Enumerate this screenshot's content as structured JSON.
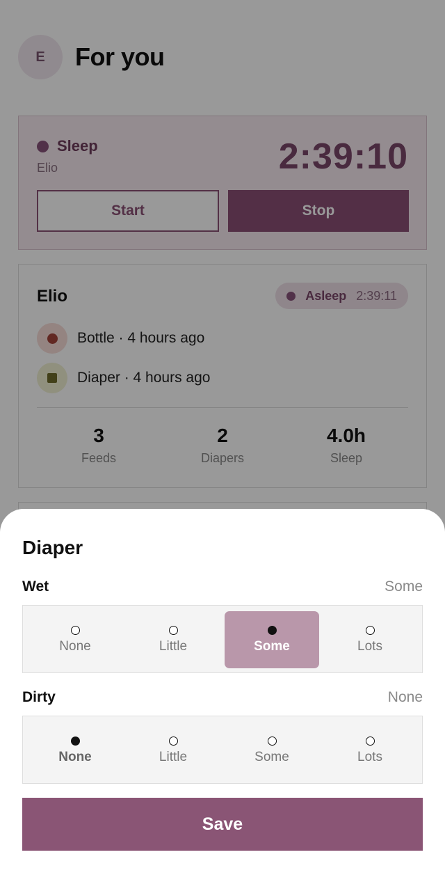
{
  "header": {
    "avatar_initial": "E",
    "title": "For you"
  },
  "timer": {
    "kind": "Sleep",
    "child": "Elio",
    "elapsed": "2:39:10",
    "start_label": "Start",
    "stop_label": "Stop"
  },
  "child_card": {
    "name": "Elio",
    "status": {
      "label": "Asleep",
      "time": "2:39:11"
    },
    "events": [
      {
        "icon": "bottle-icon",
        "text": "Bottle · 4 hours ago"
      },
      {
        "icon": "diaper-icon",
        "text": "Diaper · 4 hours ago"
      }
    ],
    "stats": [
      {
        "value": "3",
        "label": "Feeds"
      },
      {
        "value": "2",
        "label": "Diapers"
      },
      {
        "value": "4.0h",
        "label": "Sleep"
      }
    ]
  },
  "sheet": {
    "title": "Diaper",
    "wet": {
      "label": "Wet",
      "value": "Some",
      "options": [
        "None",
        "Little",
        "Some",
        "Lots"
      ],
      "selected": "Some"
    },
    "dirty": {
      "label": "Dirty",
      "value": "None",
      "options": [
        "None",
        "Little",
        "Some",
        "Lots"
      ],
      "selected": "None"
    },
    "save_label": "Save"
  },
  "colors": {
    "accent": "#8a5575",
    "accent_light": "#b997aa",
    "scrim": "rgba(0,0,0,0.4)"
  }
}
